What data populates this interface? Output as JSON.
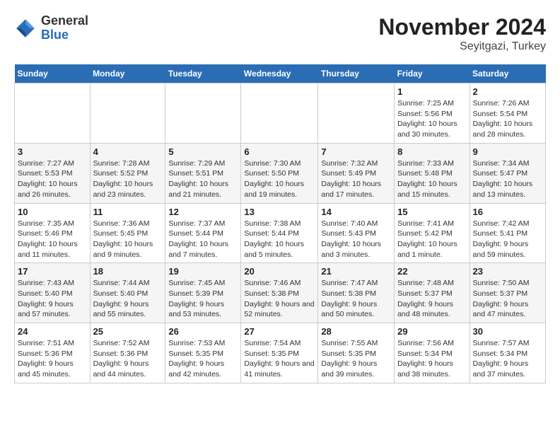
{
  "logo": {
    "line1": "General",
    "line2": "Blue"
  },
  "title": "November 2024",
  "location": "Seyitgazi, Turkey",
  "weekdays": [
    "Sunday",
    "Monday",
    "Tuesday",
    "Wednesday",
    "Thursday",
    "Friday",
    "Saturday"
  ],
  "weeks": [
    [
      {
        "day": "",
        "info": ""
      },
      {
        "day": "",
        "info": ""
      },
      {
        "day": "",
        "info": ""
      },
      {
        "day": "",
        "info": ""
      },
      {
        "day": "",
        "info": ""
      },
      {
        "day": "1",
        "info": "Sunrise: 7:25 AM\nSunset: 5:56 PM\nDaylight: 10 hours and 30 minutes."
      },
      {
        "day": "2",
        "info": "Sunrise: 7:26 AM\nSunset: 5:54 PM\nDaylight: 10 hours and 28 minutes."
      }
    ],
    [
      {
        "day": "3",
        "info": "Sunrise: 7:27 AM\nSunset: 5:53 PM\nDaylight: 10 hours and 26 minutes."
      },
      {
        "day": "4",
        "info": "Sunrise: 7:28 AM\nSunset: 5:52 PM\nDaylight: 10 hours and 23 minutes."
      },
      {
        "day": "5",
        "info": "Sunrise: 7:29 AM\nSunset: 5:51 PM\nDaylight: 10 hours and 21 minutes."
      },
      {
        "day": "6",
        "info": "Sunrise: 7:30 AM\nSunset: 5:50 PM\nDaylight: 10 hours and 19 minutes."
      },
      {
        "day": "7",
        "info": "Sunrise: 7:32 AM\nSunset: 5:49 PM\nDaylight: 10 hours and 17 minutes."
      },
      {
        "day": "8",
        "info": "Sunrise: 7:33 AM\nSunset: 5:48 PM\nDaylight: 10 hours and 15 minutes."
      },
      {
        "day": "9",
        "info": "Sunrise: 7:34 AM\nSunset: 5:47 PM\nDaylight: 10 hours and 13 minutes."
      }
    ],
    [
      {
        "day": "10",
        "info": "Sunrise: 7:35 AM\nSunset: 5:46 PM\nDaylight: 10 hours and 11 minutes."
      },
      {
        "day": "11",
        "info": "Sunrise: 7:36 AM\nSunset: 5:45 PM\nDaylight: 10 hours and 9 minutes."
      },
      {
        "day": "12",
        "info": "Sunrise: 7:37 AM\nSunset: 5:44 PM\nDaylight: 10 hours and 7 minutes."
      },
      {
        "day": "13",
        "info": "Sunrise: 7:38 AM\nSunset: 5:44 PM\nDaylight: 10 hours and 5 minutes."
      },
      {
        "day": "14",
        "info": "Sunrise: 7:40 AM\nSunset: 5:43 PM\nDaylight: 10 hours and 3 minutes."
      },
      {
        "day": "15",
        "info": "Sunrise: 7:41 AM\nSunset: 5:42 PM\nDaylight: 10 hours and 1 minute."
      },
      {
        "day": "16",
        "info": "Sunrise: 7:42 AM\nSunset: 5:41 PM\nDaylight: 9 hours and 59 minutes."
      }
    ],
    [
      {
        "day": "17",
        "info": "Sunrise: 7:43 AM\nSunset: 5:40 PM\nDaylight: 9 hours and 57 minutes."
      },
      {
        "day": "18",
        "info": "Sunrise: 7:44 AM\nSunset: 5:40 PM\nDaylight: 9 hours and 55 minutes."
      },
      {
        "day": "19",
        "info": "Sunrise: 7:45 AM\nSunset: 5:39 PM\nDaylight: 9 hours and 53 minutes."
      },
      {
        "day": "20",
        "info": "Sunrise: 7:46 AM\nSunset: 5:38 PM\nDaylight: 9 hours and 52 minutes."
      },
      {
        "day": "21",
        "info": "Sunrise: 7:47 AM\nSunset: 5:38 PM\nDaylight: 9 hours and 50 minutes."
      },
      {
        "day": "22",
        "info": "Sunrise: 7:48 AM\nSunset: 5:37 PM\nDaylight: 9 hours and 48 minutes."
      },
      {
        "day": "23",
        "info": "Sunrise: 7:50 AM\nSunset: 5:37 PM\nDaylight: 9 hours and 47 minutes."
      }
    ],
    [
      {
        "day": "24",
        "info": "Sunrise: 7:51 AM\nSunset: 5:36 PM\nDaylight: 9 hours and 45 minutes."
      },
      {
        "day": "25",
        "info": "Sunrise: 7:52 AM\nSunset: 5:36 PM\nDaylight: 9 hours and 44 minutes."
      },
      {
        "day": "26",
        "info": "Sunrise: 7:53 AM\nSunset: 5:35 PM\nDaylight: 9 hours and 42 minutes."
      },
      {
        "day": "27",
        "info": "Sunrise: 7:54 AM\nSunset: 5:35 PM\nDaylight: 9 hours and 41 minutes."
      },
      {
        "day": "28",
        "info": "Sunrise: 7:55 AM\nSunset: 5:35 PM\nDaylight: 9 hours and 39 minutes."
      },
      {
        "day": "29",
        "info": "Sunrise: 7:56 AM\nSunset: 5:34 PM\nDaylight: 9 hours and 38 minutes."
      },
      {
        "day": "30",
        "info": "Sunrise: 7:57 AM\nSunset: 5:34 PM\nDaylight: 9 hours and 37 minutes."
      }
    ]
  ]
}
